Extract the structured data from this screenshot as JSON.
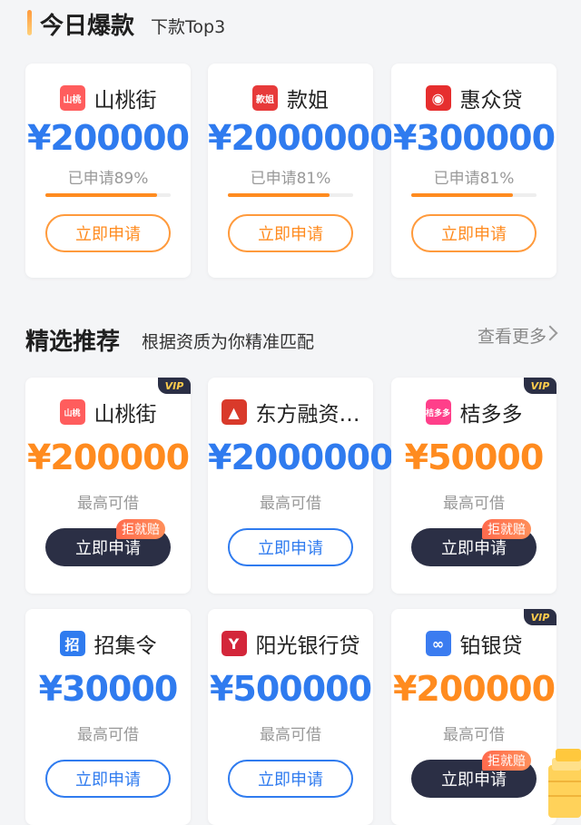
{
  "top": {
    "title": "今日爆款",
    "subtitle": "下款Top3",
    "cards": [
      {
        "name": "山桃街",
        "logo_text": "山桃",
        "logo_color": "#ff5d5d",
        "amount": "¥200000",
        "applied": "已申请89%",
        "progress": 0.89,
        "button": "立即申请"
      },
      {
        "name": "款姐",
        "logo_text": "款姐",
        "logo_color": "#e73a3a",
        "amount": "¥2000000",
        "applied": "已申请81%",
        "progress": 0.81,
        "button": "立即申请"
      },
      {
        "name": "惠众贷",
        "logo_text": "◉",
        "logo_color": "#e62e2e",
        "amount": "¥300000",
        "applied": "已申请81%",
        "progress": 0.81,
        "button": "立即申请"
      }
    ]
  },
  "rec": {
    "title": "精选推荐",
    "subtitle": "根据资质为你精准匹配",
    "more": "查看更多",
    "max_label": "最高可借",
    "vip_label": "VIP",
    "badge_label": "拒就赔",
    "cards": [
      {
        "name": "山桃街",
        "logo_text": "山桃",
        "logo_color": "#ff5d5d",
        "amount": "¥200000",
        "amount_color": "orange",
        "button": "立即申请",
        "button_style": "dark",
        "vip": true,
        "badge": true
      },
      {
        "name": "东方融资…",
        "logo_text": "▲",
        "logo_color": "#d93a2b",
        "amount": "¥2000000",
        "amount_color": "blue",
        "button": "立即申请",
        "button_style": "outline",
        "vip": false,
        "badge": false
      },
      {
        "name": "桔多多",
        "logo_text": "桔多多",
        "logo_color": "#ff3f8a",
        "amount": "¥50000",
        "amount_color": "orange",
        "button": "立即申请",
        "button_style": "dark",
        "vip": true,
        "badge": true
      },
      {
        "name": "招集令",
        "logo_text": "招",
        "logo_color": "#2f7bef",
        "amount": "¥30000",
        "amount_color": "blue",
        "button": "立即申请",
        "button_style": "outline",
        "vip": false,
        "badge": false
      },
      {
        "name": "阳光银行贷",
        "logo_text": "Y",
        "logo_color": "#d3263a",
        "amount": "¥500000",
        "amount_color": "blue",
        "button": "立即申请",
        "button_style": "outline",
        "vip": false,
        "badge": false
      },
      {
        "name": "铂银贷",
        "logo_text": "∞",
        "logo_color": "#3b7cf0",
        "amount": "¥200000",
        "amount_color": "orange",
        "button": "立即申请",
        "button_style": "dark",
        "vip": true,
        "badge": true
      }
    ]
  }
}
